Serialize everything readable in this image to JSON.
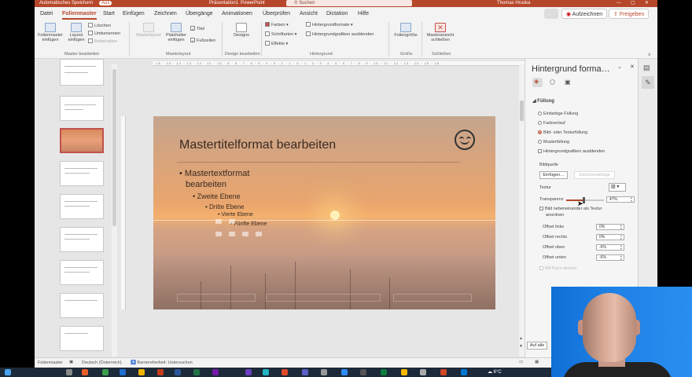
{
  "titlebar": {
    "autosave": "Automatisches Speichern",
    "autosave_state": "Aus",
    "file": "Präsentation1",
    "app": "PowerPoint",
    "search": "Suchen",
    "user": "Thomas Hruska"
  },
  "menu": {
    "tabs": [
      "Datei",
      "Folienmaster",
      "Start",
      "Einfügen",
      "Zeichnen",
      "Übergänge",
      "Animationen",
      "Überprüfen",
      "Ansicht",
      "Dictation",
      "Hilfe"
    ],
    "active_tab": "Folienmaster",
    "record": "Aufzeichnen",
    "share": "Freigeben"
  },
  "ribbon": {
    "insert_master": "Folienmaster einfügen",
    "insert_layout": "Layout einfügen",
    "delete": "Löschen",
    "rename": "Umbenennen",
    "preserve": "Beibehalten",
    "group_master": "Master bearbeiten",
    "master_layout": "Masterlayout",
    "insert_placeholder": "Platzhalter einfügen",
    "title_cb": "Titel",
    "footer_cb": "Fußzeilen",
    "group_masterlayout": "Masterlayout",
    "designs": "Designs",
    "group_design": "Design bearbeiten",
    "colors": "Farben",
    "fonts": "Schriftarten",
    "effects": "Effekte",
    "bg_styles": "Hintergrundformate",
    "hide_bg": "Hintergrundgrafiken ausblenden",
    "group_bg": "Hintergrund",
    "slide_size": "Foliengröße",
    "group_size": "Größe",
    "close_master": "Masteransicht schließen",
    "group_close": "Schließen"
  },
  "ruler": "· 16 · 15 · 14 · 13 · 12 · 11 · 10 · 9 · 8 · 7 · 6 · 5 · 4 · 3 · 2 · 1 · 0 · 1 · 2 · 3 · 4 · 5 · 6 · 7 · 8 · 9 · 10 · 11 · 12 · 13 · 14 · 15 · 16 ·",
  "slide": {
    "title": "Mastertitelformat bearbeiten",
    "level1": "Mastertextformat",
    "level1b": "bearbeiten",
    "level2": "Zweite Ebene",
    "level3": "Dritte Ebene",
    "level4": "Vierte Ebene",
    "level5": "Fünfte Ebene"
  },
  "pane": {
    "title": "Hintergrund forma…",
    "section": "Füllung",
    "options": [
      "Einfarbige Füllung",
      "Farbverlauf",
      "Bild- oder Texturfüllung",
      "Musterfüllung"
    ],
    "selected_option": "Bild- oder Texturfüllung",
    "hide_bg_graphics": "Hintergrundgrafiken ausblenden",
    "image_source": "Bildquelle",
    "insert_btn": "Einfügen…",
    "clipboard_btn": "Zwischenablage",
    "texture": "Textur",
    "transparency": "Transparenz",
    "transparency_value": "47%",
    "tile": "Bild nebeneinander als Textur",
    "tile2": "anordnen",
    "offset_left": "Offset links",
    "offset_left_val": "0%",
    "offset_right": "Offset rechts",
    "offset_right_val": "0%",
    "offset_top": "Offset oben",
    "offset_top_val": "-6%",
    "offset_bottom": "Offset unten",
    "offset_bottom_val": "-6%",
    "rotate": "Mit Form drehen",
    "apply_all": "Auf alle"
  },
  "status": {
    "view": "Folienmaster",
    "lang": "Deutsch (Österreich)",
    "accessibility": "Barrierefreiheit: Untersuchen"
  },
  "taskbar": {
    "weather": "6°C"
  },
  "colors": {
    "accent": "#b7472a",
    "webcam_bg": "#1e7fe5"
  }
}
